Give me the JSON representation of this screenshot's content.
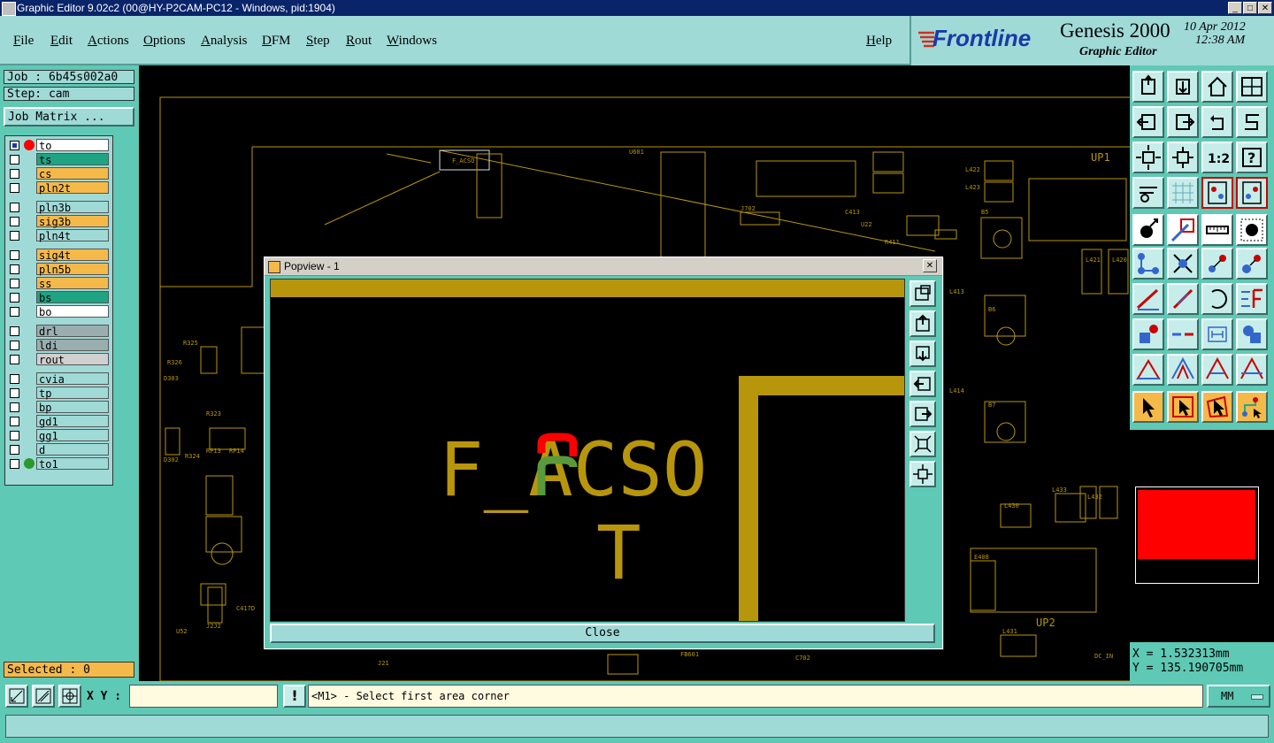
{
  "window": {
    "title": "Graphic Editor 9.02c2 (00@HY-P2CAM-PC12 - Windows, pid:1904)",
    "minimize": "_",
    "maximize": "□",
    "close": "✕"
  },
  "menus": [
    "File",
    "Edit",
    "Actions",
    "Options",
    "Analysis",
    "DFM",
    "Step",
    "Rout",
    "Windows"
  ],
  "help": "Help",
  "brand": {
    "logo": "Frontline",
    "product": "Genesis 2000",
    "subtitle": "Graphic Editor",
    "date": "10 Apr 2012",
    "time": "12:38 AM"
  },
  "job": {
    "job_label": "Job : 6b45s002a0",
    "step_label": "Step: cam",
    "matrix_button": "Job Matrix ..."
  },
  "layers": [
    {
      "name": "to",
      "color": "#ffffff",
      "group": 0
    },
    {
      "name": "ts",
      "color": "#1fa483",
      "group": 0
    },
    {
      "name": "cs",
      "color": "#f5b94a",
      "group": 0
    },
    {
      "name": "pln2t",
      "color": "#f5b94a",
      "group": 0
    },
    {
      "name": "pln3b",
      "color": "#9fdad7",
      "group": 1
    },
    {
      "name": "sig3b",
      "color": "#f5b94a",
      "group": 1
    },
    {
      "name": "pln4t",
      "color": "#9fdad7",
      "group": 1
    },
    {
      "name": "sig4t",
      "color": "#f5b94a",
      "group": 2
    },
    {
      "name": "pln5b",
      "color": "#f5b94a",
      "group": 2
    },
    {
      "name": "ss",
      "color": "#f5b94a",
      "group": 2
    },
    {
      "name": "bs",
      "color": "#1fa483",
      "group": 2
    },
    {
      "name": "bo",
      "color": "#ffffff",
      "group": 2
    },
    {
      "name": "drl",
      "color": "#9aaeb0",
      "group": 3
    },
    {
      "name": "ldi",
      "color": "#9aaeb0",
      "group": 3
    },
    {
      "name": "rout",
      "color": "#d0d0d0",
      "group": 3
    },
    {
      "name": "cvia",
      "color": "#9fdad7",
      "group": 4
    },
    {
      "name": "tp",
      "color": "#9fdad7",
      "group": 4
    },
    {
      "name": "bp",
      "color": "#9fdad7",
      "group": 4
    },
    {
      "name": "gd1",
      "color": "#9fdad7",
      "group": 4
    },
    {
      "name": "gg1",
      "color": "#9fdad7",
      "group": 4
    },
    {
      "name": "d",
      "color": "#9fdad7",
      "group": 4
    },
    {
      "name": "to1",
      "color": "#9fdad7",
      "group": 4
    }
  ],
  "selected": "Selected : 0",
  "popup": {
    "title": "Popview - 1",
    "text_line1": "F_ACSO",
    "text_line2": "T",
    "close_button": "Close",
    "close_x": "✕"
  },
  "canvas_labels": [
    "F_ACSO",
    "UP1",
    "UP2",
    "R326",
    "R325",
    "R323",
    "R324",
    "D303",
    "D302",
    "RP13",
    "RP14",
    "R411",
    "C413",
    "E408",
    "L421",
    "L420",
    "L422",
    "L423",
    "L413",
    "L414",
    "L430",
    "L431",
    "L433",
    "L432",
    "B5",
    "B6",
    "B7",
    "J21",
    "FB601",
    "C702",
    "DC_IN",
    "U601",
    "J702",
    "U22",
    "J2J2",
    "U52",
    "C417D"
  ],
  "coords": {
    "x": "X = 1.532313mm",
    "y": "Y = 135.190705mm"
  },
  "status": {
    "xy_label": "X Y :",
    "xy_value": "",
    "prompt": "<M1> - Select first area corner",
    "units": "MM",
    "warn": "!"
  },
  "colors": {
    "accent": "#5ec9b4",
    "panel": "#9fdad7",
    "trace": "#b8960c",
    "highlight_red": "#ff0000",
    "highlight_green": "#5a9a3a"
  }
}
